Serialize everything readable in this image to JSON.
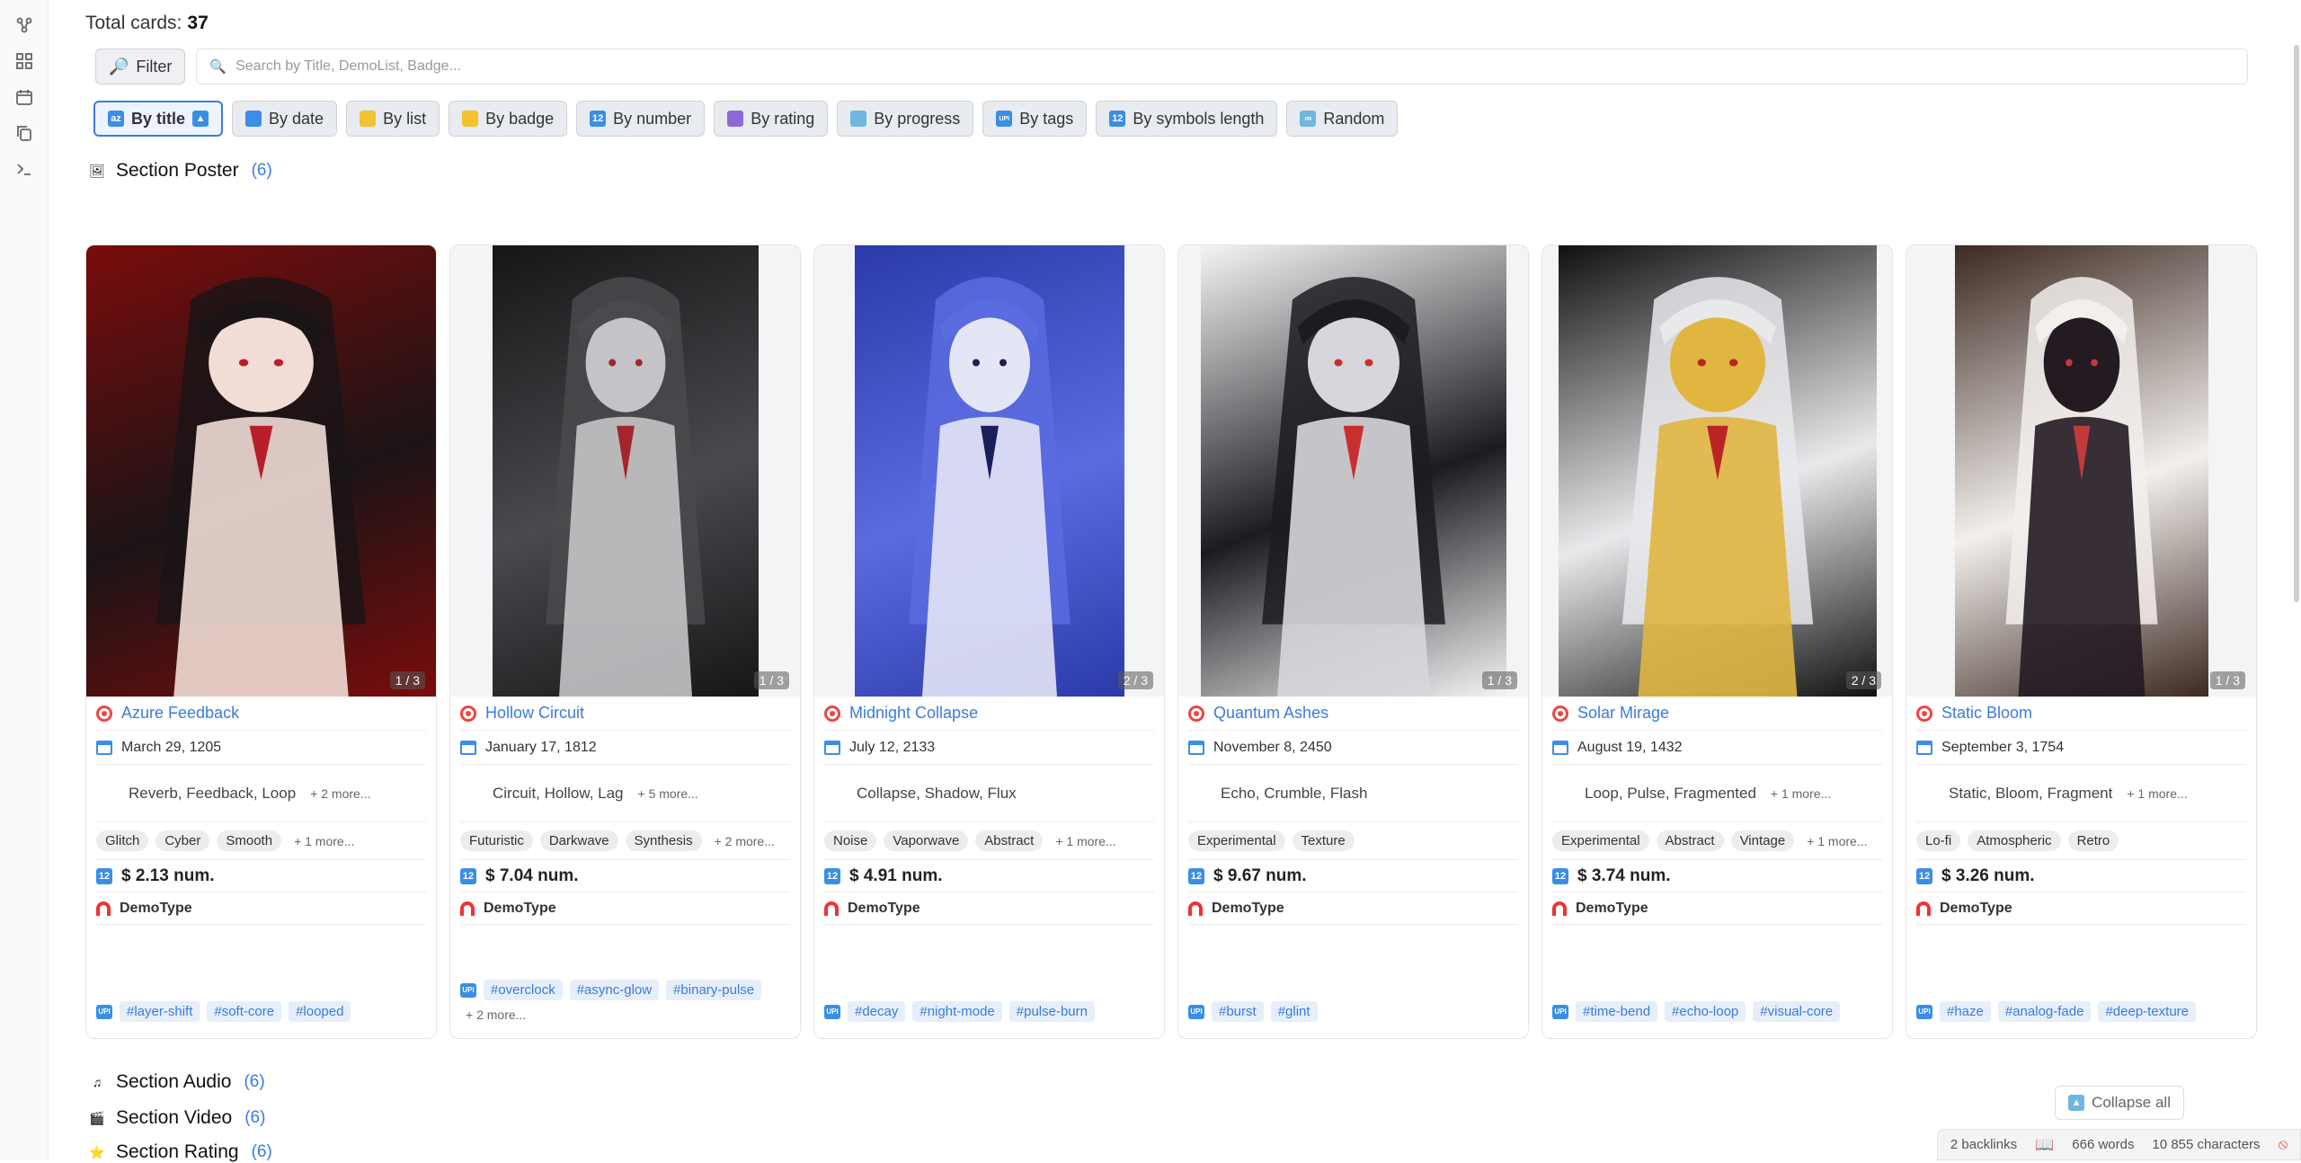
{
  "header": {
    "total_label": "Total cards:",
    "total_value": "37"
  },
  "filter": {
    "button_label": "Filter",
    "search_placeholder": "Search by Title, DemoList, Badge..."
  },
  "sorts": [
    {
      "label": "By title",
      "icon": "sort-title-icon",
      "active": true
    },
    {
      "label": "By date",
      "icon": "calendar-icon"
    },
    {
      "label": "By list",
      "icon": "tag-icon"
    },
    {
      "label": "By badge",
      "icon": "tag-icon"
    },
    {
      "label": "By number",
      "icon": "number-icon"
    },
    {
      "label": "By rating",
      "icon": "bar-chart-icon"
    },
    {
      "label": "By progress",
      "icon": "trend-icon"
    },
    {
      "label": "By tags",
      "icon": "upi-icon"
    },
    {
      "label": "By symbols length",
      "icon": "number-icon"
    },
    {
      "label": "Random",
      "icon": "infinity-icon"
    }
  ],
  "sections": [
    {
      "title": "Section Poster",
      "count": "(6)",
      "icon": "picture-icon"
    },
    {
      "title": "Section Audio",
      "count": "(6)",
      "icon": "music-note-icon"
    },
    {
      "title": "Section Video",
      "count": "(6)",
      "icon": "clapperboard-icon"
    },
    {
      "title": "Section Rating",
      "count": "(6)",
      "icon": "star-icon"
    }
  ],
  "cards": [
    {
      "title": "Azure Feedback",
      "date": "March 29, 1205",
      "words": "Reverb, Feedback, Loop",
      "words_more": "+ 2 more...",
      "tags": [
        "Glitch",
        "Cyber",
        "Smooth"
      ],
      "tags_more": "+ 1 more...",
      "price": "$ 2.13 num.",
      "type": "DemoType",
      "hashtags": [
        "#layer-shift",
        "#soft-core",
        "#looped"
      ],
      "hash_more": "",
      "pager": "1 / 3",
      "palette": [
        "#7a0c0c",
        "#1b1416",
        "#f1ddd5",
        "#b81f2a"
      ]
    },
    {
      "title": "Hollow Circuit",
      "date": "January 17, 1812",
      "words": "Circuit, Hollow, Lag",
      "words_more": "+ 5 more...",
      "tags": [
        "Futuristic",
        "Darkwave",
        "Synthesis"
      ],
      "tags_more": "+ 2 more...",
      "price": "$ 7.04 num.",
      "type": "DemoType",
      "hashtags": [
        "#overclock",
        "#async-glow",
        "#binary-pulse"
      ],
      "hash_more": "+ 2 more...",
      "pager": "1 / 3",
      "palette": [
        "#161618",
        "#4a4a4e",
        "#c4c4c8",
        "#a3262c"
      ]
    },
    {
      "title": "Midnight Collapse",
      "date": "July 12, 2133",
      "words": "Collapse, Shadow, Flux",
      "words_more": "",
      "tags": [
        "Noise",
        "Vaporwave",
        "Abstract"
      ],
      "tags_more": "+ 1 more...",
      "price": "$ 4.91 num.",
      "type": "DemoType",
      "hashtags": [
        "#decay",
        "#night-mode",
        "#pulse-burn"
      ],
      "hash_more": "",
      "pager": "2 / 3",
      "palette": [
        "#2b3aa8",
        "#5b6be0",
        "#e4e6f6",
        "#1a1f5c"
      ]
    },
    {
      "title": "Quantum Ashes",
      "date": "November 8, 2450",
      "words": "Echo, Crumble, Flash",
      "words_more": "",
      "tags": [
        "Experimental",
        "Texture"
      ],
      "tags_more": "",
      "price": "$ 9.67 num.",
      "type": "DemoType",
      "hashtags": [
        "#burst",
        "#glint"
      ],
      "hash_more": "",
      "pager": "1 / 3",
      "palette": [
        "#f4f4f6",
        "#1c1c20",
        "#d8d6dc",
        "#c92f2f"
      ]
    },
    {
      "title": "Solar Mirage",
      "date": "August 19, 1432",
      "words": "Loop, Pulse, Fragmented",
      "words_more": "+ 1 more...",
      "tags": [
        "Experimental",
        "Abstract",
        "Vintage"
      ],
      "tags_more": "+ 1 more...",
      "price": "$ 3.74 num.",
      "type": "DemoType",
      "hashtags": [
        "#time-bend",
        "#echo-loop",
        "#visual-core"
      ],
      "hash_more": "",
      "pager": "2 / 3",
      "palette": [
        "#101012",
        "#e9e9ec",
        "#e0b640",
        "#b92525"
      ]
    },
    {
      "title": "Static Bloom",
      "date": "September 3, 1754",
      "words": "Static, Bloom, Fragment",
      "words_more": "+ 1 more...",
      "tags": [
        "Lo-fi",
        "Atmospheric",
        "Retro"
      ],
      "tags_more": "",
      "price": "$ 3.26 num.",
      "type": "DemoType",
      "hashtags": [
        "#haze",
        "#analog-fade",
        "#deep-texture"
      ],
      "hash_more": "",
      "pager": "1 / 3",
      "palette": [
        "#3d2a22",
        "#f2efec",
        "#241a22",
        "#c23a3a"
      ]
    }
  ],
  "collapse_label": "Collapse all",
  "status": {
    "backlinks": "2 backlinks",
    "words": "666 words",
    "characters": "10 855 characters"
  }
}
